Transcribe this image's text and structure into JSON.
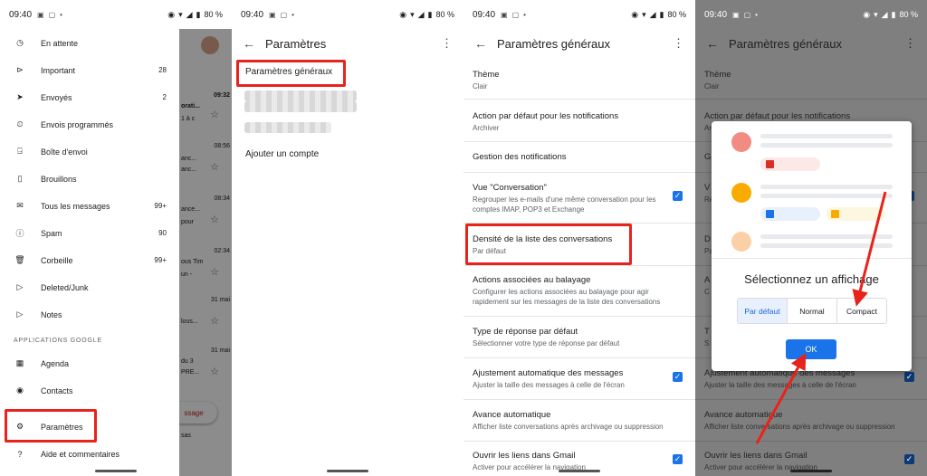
{
  "status": {
    "time": "09:40",
    "battery": "80 %"
  },
  "drawer": {
    "items": [
      {
        "label": "En attente",
        "count": ""
      },
      {
        "label": "Important",
        "count": "28"
      },
      {
        "label": "Envoyés",
        "count": "2"
      },
      {
        "label": "Envois programmés",
        "count": ""
      },
      {
        "label": "Boîte d'envoi",
        "count": ""
      },
      {
        "label": "Brouillons",
        "count": ""
      },
      {
        "label": "Tous les messages",
        "count": "99+"
      },
      {
        "label": "Spam",
        "count": "90"
      },
      {
        "label": "Corbeille",
        "count": "99+"
      },
      {
        "label": "Deleted/Junk",
        "count": ""
      },
      {
        "label": "Notes",
        "count": ""
      }
    ],
    "section": "APPLICATIONS GOOGLE",
    "apps": [
      {
        "label": "Agenda"
      },
      {
        "label": "Contacts"
      }
    ],
    "settings": "Paramètres",
    "help": "Aide et commentaires",
    "behind": {
      "times": [
        "09:32",
        "08:56",
        "08:34",
        "02:34",
        "31 mai",
        "31 mai"
      ],
      "snippets": [
        "orati...",
        "1 à c",
        "anc...",
        "anc...",
        "ance...",
        "pour",
        "ous Tim",
        "un -",
        "lous...",
        "du 3",
        "PRE..."
      ],
      "compose": "ssage",
      "last": "sas"
    }
  },
  "screen2": {
    "title": "Paramètres",
    "general": "Paramètres généraux",
    "add": "Ajouter un compte"
  },
  "screen3": {
    "title": "Paramètres généraux",
    "items": [
      {
        "title": "Thème",
        "desc": "Clair"
      },
      {
        "title": "Action par défaut pour les notifications",
        "desc": "Archiver"
      },
      {
        "title": "Gestion des notifications",
        "desc": ""
      },
      {
        "title": "Vue \"Conversation\"",
        "desc": "Regrouper les e-mails d'une même conversation pour les comptes IMAP, POP3 et Exchange"
      },
      {
        "title": "Densité de la liste des conversations",
        "desc": "Par défaut"
      },
      {
        "title": "Actions associées au balayage",
        "desc": "Configurer les actions associées au balayage pour agir rapidement sur les messages de la liste des conversations"
      },
      {
        "title": "Type de réponse par défaut",
        "desc": "Sélectionner votre type de réponse par défaut"
      },
      {
        "title": "Ajustement automatique des messages",
        "desc": "Ajuster la taille des messages à celle de l'écran"
      },
      {
        "title": "Avance automatique",
        "desc": "Afficher liste conversations après archivage ou suppression"
      },
      {
        "title": "Ouvrir les liens dans Gmail",
        "desc": "Activer pour accélérer la navigation"
      }
    ]
  },
  "screen4": {
    "title": "Paramètres généraux",
    "bg": [
      {
        "title": "Thème",
        "desc": "Clair"
      },
      {
        "title": "Action par défaut pour les notifications",
        "desc": "Ar"
      },
      {
        "title": "G",
        "desc": ""
      },
      {
        "title": "V",
        "desc": "Re"
      },
      {
        "title": "D",
        "desc": "Pa"
      },
      {
        "title": "A",
        "desc": "C"
      },
      {
        "title": "T",
        "desc": "S"
      },
      {
        "title": "Ajustement automatique des messages",
        "desc": "Ajuster la taille des messages à celle de l'écran"
      },
      {
        "title": "Avance automatique",
        "desc": "Afficher liste conversations après archivage ou suppression"
      },
      {
        "title": "Ouvrir les liens dans Gmail",
        "desc": "Activer pour accélérer la navigation"
      }
    ],
    "dialog": {
      "title": "Sélectionnez un affichage",
      "options": [
        "Par défaut",
        "Normal",
        "Compact"
      ],
      "ok": "OK"
    }
  }
}
